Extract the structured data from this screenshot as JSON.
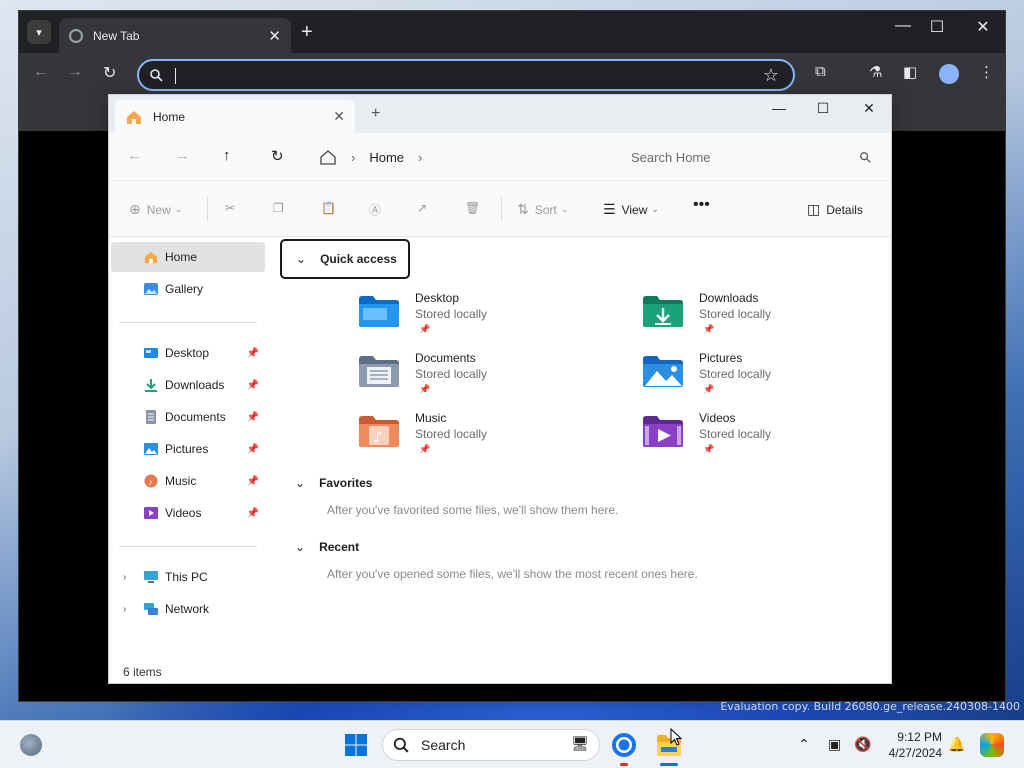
{
  "browser": {
    "tab_title": "New Tab",
    "omnibox_value": ""
  },
  "explorer": {
    "tab_title": "Home",
    "breadcrumb": [
      "Home"
    ],
    "search_placeholder": "Search Home",
    "commands": {
      "new": "New",
      "sort": "Sort",
      "view": "View",
      "details": "Details"
    },
    "nav": {
      "top": [
        {
          "label": "Home",
          "icon": "home-icon",
          "selected": true
        },
        {
          "label": "Gallery",
          "icon": "gallery-icon",
          "selected": false
        }
      ],
      "pinned": [
        {
          "label": "Desktop",
          "icon": "desktop-folder-icon"
        },
        {
          "label": "Downloads",
          "icon": "downloads-icon"
        },
        {
          "label": "Documents",
          "icon": "documents-icon"
        },
        {
          "label": "Pictures",
          "icon": "pictures-icon"
        },
        {
          "label": "Music",
          "icon": "music-icon"
        },
        {
          "label": "Videos",
          "icon": "videos-icon"
        }
      ],
      "bottom": [
        {
          "label": "This PC",
          "icon": "this-pc-icon"
        },
        {
          "label": "Network",
          "icon": "network-icon"
        }
      ]
    },
    "sections": {
      "quick_access": "Quick access",
      "favorites": "Favorites",
      "favorites_empty": "After you've favorited some files, we'll show them here.",
      "recent": "Recent",
      "recent_empty": "After you've opened some files, we'll show the most recent ones here."
    },
    "quick_access_items": [
      {
        "name": "Desktop",
        "sub": "Stored locally",
        "color": "#1e88e5"
      },
      {
        "name": "Downloads",
        "sub": "Stored locally",
        "color": "#1aa37a"
      },
      {
        "name": "Documents",
        "sub": "Stored locally",
        "color": "#7d8fa8"
      },
      {
        "name": "Pictures",
        "sub": "Stored locally",
        "color": "#2b8fe0"
      },
      {
        "name": "Music",
        "sub": "Stored locally",
        "color": "#e8764f"
      },
      {
        "name": "Videos",
        "sub": "Stored locally",
        "color": "#8a3fc7"
      }
    ],
    "status": "6 items"
  },
  "desktop": {
    "watermark": "Evaluation copy. Build 26080.ge_release.240308-1400"
  },
  "taskbar": {
    "search_label": "Search",
    "time": "9:12 PM",
    "date": "4/27/2024"
  }
}
